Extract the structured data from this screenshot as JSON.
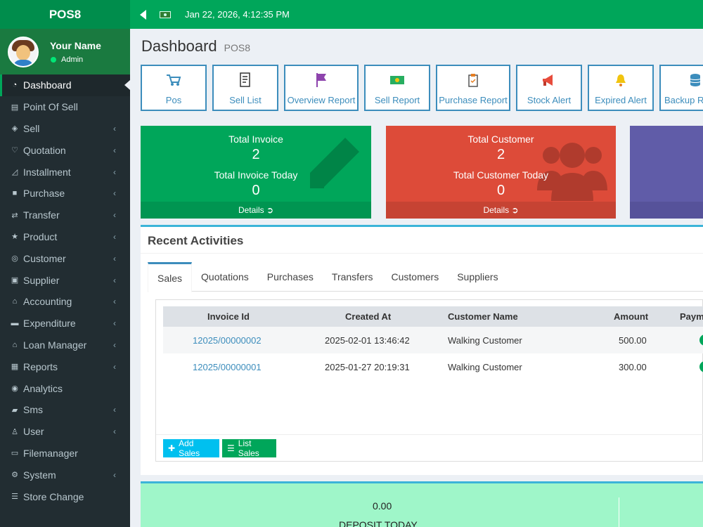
{
  "brand": "POS8",
  "topbar": {
    "datetime": "Jan 22, 2026, 4:12:35 PM"
  },
  "user": {
    "name": "Your Name",
    "role": "Admin"
  },
  "sidebar": {
    "items": [
      {
        "label": "Dashboard",
        "icon": "dashboard-icon"
      },
      {
        "label": "Point Of Sell",
        "icon": "pos-icon"
      },
      {
        "label": "Sell",
        "icon": "sell-icon"
      },
      {
        "label": "Quotation",
        "icon": "heart-icon"
      },
      {
        "label": "Installment",
        "icon": "installment-icon"
      },
      {
        "label": "Purchase",
        "icon": "bag-icon"
      },
      {
        "label": "Transfer",
        "icon": "transfer-icon"
      },
      {
        "label": "Product",
        "icon": "star-icon"
      },
      {
        "label": "Customer",
        "icon": "customer-icon"
      },
      {
        "label": "Supplier",
        "icon": "supplier-icon"
      },
      {
        "label": "Accounting",
        "icon": "bank-icon"
      },
      {
        "label": "Expenditure",
        "icon": "minus-icon"
      },
      {
        "label": "Loan Manager",
        "icon": "loan-icon"
      },
      {
        "label": "Reports",
        "icon": "report-icon"
      },
      {
        "label": "Analytics",
        "icon": "analytics-icon"
      },
      {
        "label": "Sms",
        "icon": "sms-icon"
      },
      {
        "label": "User",
        "icon": "user-icon"
      },
      {
        "label": "Filemanager",
        "icon": "file-icon"
      },
      {
        "label": "System",
        "icon": "gear-icon"
      },
      {
        "label": "Store Change",
        "icon": "list-icon"
      }
    ]
  },
  "page": {
    "title": "Dashboard",
    "subtitle": "POS8"
  },
  "shortcuts": [
    {
      "label": "Pos",
      "icon": "cart-icon"
    },
    {
      "label": "Sell List",
      "icon": "receipt-icon"
    },
    {
      "label": "Overview Report",
      "icon": "flag-icon"
    },
    {
      "label": "Sell Report",
      "icon": "money-icon"
    },
    {
      "label": "Purchase Report",
      "icon": "clipboard-icon"
    },
    {
      "label": "Stock Alert",
      "icon": "megaphone-icon"
    },
    {
      "label": "Expired Alert",
      "icon": "bell-icon"
    },
    {
      "label": "Backup R",
      "icon": "database-icon"
    }
  ],
  "stats": [
    {
      "label": "Total Invoice",
      "value": "2",
      "today_label": "Total Invoice Today",
      "today_value": "0",
      "footer": "Details",
      "color": "#00a65a"
    },
    {
      "label": "Total Customer",
      "value": "2",
      "today_label": "Total Customer Today",
      "today_value": "0",
      "footer": "Details",
      "color": "#dd4b39"
    },
    {
      "color": "#605ca8"
    }
  ],
  "activities": {
    "title": "Recent Activities",
    "tabs": [
      "Sales",
      "Quotations",
      "Purchases",
      "Transfers",
      "Customers",
      "Suppliers"
    ],
    "columns": [
      "Invoice Id",
      "Created At",
      "Customer Name",
      "Amount",
      "Payme"
    ],
    "rows": [
      {
        "invoice": "12025/00000002",
        "created": "2025-02-01 13:46:42",
        "customer": "Walking Customer",
        "amount": "500.00"
      },
      {
        "invoice": "12025/00000001",
        "created": "2025-01-27 20:19:31",
        "customer": "Walking Customer",
        "amount": "300.00"
      }
    ],
    "add_label": "Add Sales",
    "list_label": "List Sales"
  },
  "deposit": {
    "value": "0.00",
    "label": "DEPOSIT TODAY"
  }
}
